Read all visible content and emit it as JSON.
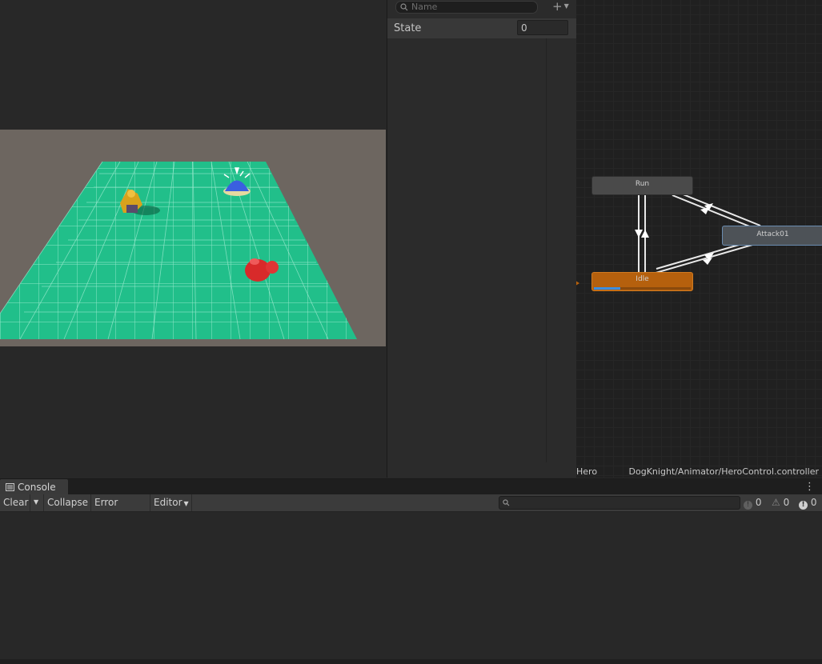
{
  "parameters": {
    "search_placeholder": "Name",
    "add_label": "+",
    "items": [
      {
        "name": "State",
        "value": "0"
      }
    ]
  },
  "animator": {
    "states": {
      "run": "Run",
      "attack": "Attack01",
      "idle": "Idle"
    },
    "idle_progress": 0.27,
    "footer_left": "Hero",
    "footer_right": "DogKnight/Animator/HeroControl.controller"
  },
  "console": {
    "tab_label": "Console",
    "toolbar": {
      "clear": "Clear",
      "collapse": "Collapse",
      "error_pause": "Error Pause",
      "editor": "Editor"
    },
    "counts": {
      "info": "0",
      "warning": "0",
      "error": "0"
    }
  },
  "colors": {
    "idle_state": "#b5600d",
    "entry_transition": "#b5600d",
    "attack_highlight": "#6a8cb0",
    "floor": "#22c08a",
    "ground": "#6d6660"
  }
}
